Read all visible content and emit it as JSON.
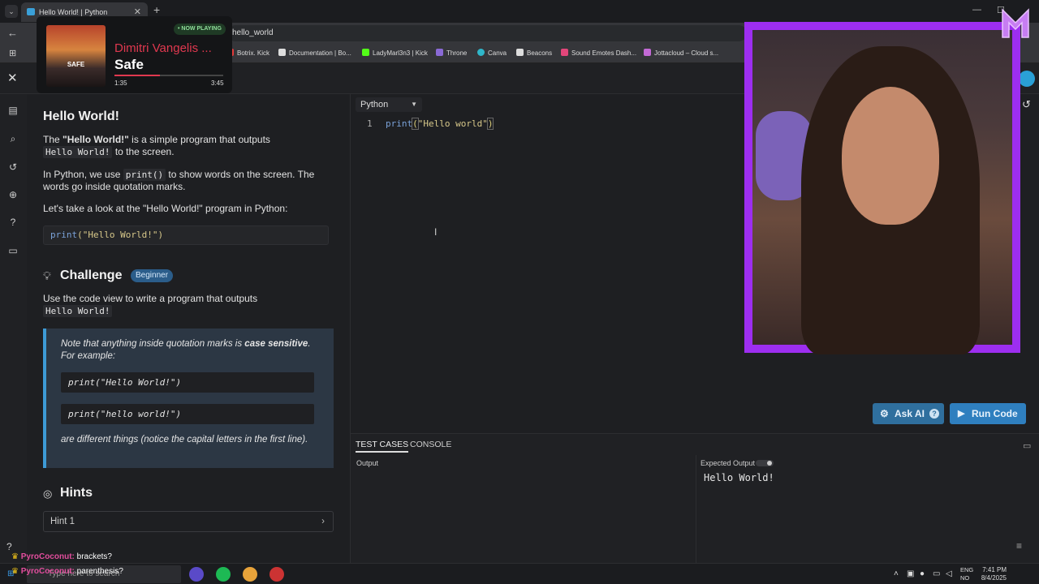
{
  "browser": {
    "tab_title": "Hello World! | Python",
    "address": "hello_world",
    "bookmarks": [
      "Botrix. Kick",
      "Documentation | Bo...",
      "LadyMarl3n3 | Kick",
      "Throne",
      "Canva",
      "Beacons",
      "Sound Emotes Dash...",
      "Jottacloud – Cloud s..."
    ]
  },
  "now_playing": {
    "state": "• NOW PLAYING",
    "artist": "Dimitri Vangelis ...",
    "song": "Safe",
    "art_label": "SAFE",
    "elapsed": "1:35",
    "duration": "3:45",
    "progress": 0.42
  },
  "lesson": {
    "title": "Hello World!",
    "p1_pre": "The ",
    "p1_bold": "\"Hello World!\"",
    "p1_post": " is a simple program that outputs",
    "p1_code": "Hello World!",
    "p1_end": " to the screen.",
    "p2_pre": "In Python, we use ",
    "p2_code": "print()",
    "p2_post": " to show words on the screen. The words go inside quotation marks.",
    "p3": "Let's take a look at the \"Hello World!\" program in Python:",
    "example_fn": "print",
    "example_str": "(\"Hello World!\")",
    "challenge_title": "Challenge",
    "challenge_badge": "Beginner",
    "challenge_text": "Use the code view to write a program that outputs",
    "challenge_code": "Hello World!",
    "note_pre": "Note that anything inside quotation marks is ",
    "note_bold": "case sensitive",
    "note_post": ". For example:",
    "note_code1": "print(\"Hello World!\")",
    "note_code2": "print(\"hello world!\")",
    "note_after": "are different things (notice the capital letters in the first line).",
    "hints_title": "Hints",
    "hint1": "Hint 1"
  },
  "editor": {
    "language": "Python",
    "line_number": "1",
    "code_fn": "print",
    "code_open": "(",
    "code_str": "\"Hello world\"",
    "code_close": ")"
  },
  "actions": {
    "ask_ai": "Ask AI",
    "run_code": "Run Code"
  },
  "tests": {
    "tab_tests": "TEST CASES",
    "tab_console": "CONSOLE",
    "output_label": "Output",
    "expected_label": "Expected Output",
    "expected_value": "Hello World!"
  },
  "chat": [
    {
      "user": "PyroCoconut:",
      "msg": "brackets?"
    },
    {
      "user": "PyroCoconut:",
      "msg": "parenthesis?"
    }
  ],
  "taskbar": {
    "search_placeholder": "Type here to search",
    "lang_top": "ENG",
    "lang_bottom": "NO",
    "time": "7:41 PM",
    "date": "8/4/2025"
  }
}
